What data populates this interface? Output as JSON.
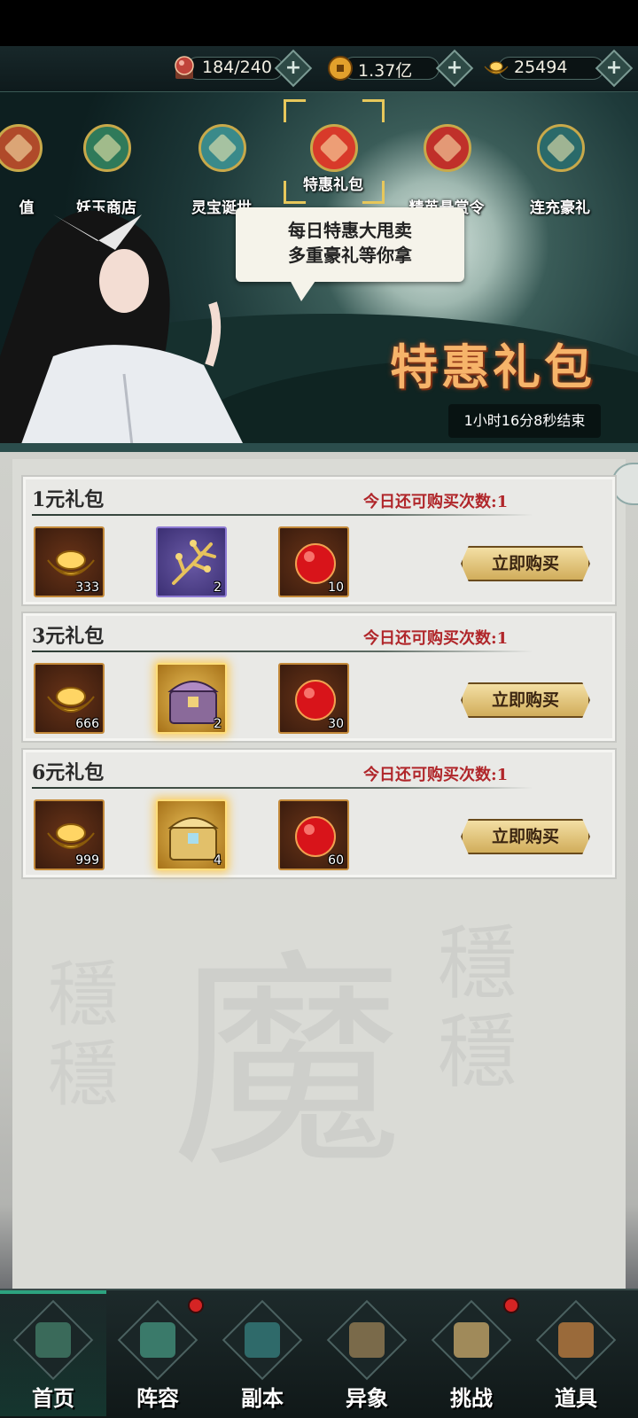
{
  "resources": [
    {
      "name": "stamina",
      "value": "184/240",
      "icon": "stamina-orb-icon",
      "color": "#c0443a"
    },
    {
      "name": "coins",
      "value": "1.37亿",
      "icon": "coin-icon",
      "color": "#e2a02c"
    },
    {
      "name": "gold_ingots",
      "value": "25494",
      "icon": "gold-ingot-icon",
      "color": "#f0b834"
    }
  ],
  "banner": {
    "categories": [
      {
        "label": "值",
        "icon": "recharge-icon",
        "selected": false
      },
      {
        "label": "妖玉商店",
        "icon": "jade-shop-icon",
        "selected": false
      },
      {
        "label": "灵宝诞世",
        "icon": "spirit-treasure-icon",
        "selected": false
      },
      {
        "label": "特惠礼包",
        "icon": "gift-box-icon",
        "selected": true
      },
      {
        "label": "精英悬赏令",
        "icon": "elite-bounty-icon",
        "selected": false
      },
      {
        "label": "连充豪礼",
        "icon": "continuous-recharge-icon",
        "selected": false
      }
    ],
    "bubble_line1": "每日特惠大甩卖",
    "bubble_line2": "多重豪礼等你拿",
    "title": "特惠礼包",
    "timer": "1小时16分8秒结束"
  },
  "packs": [
    {
      "name": "1元礼包",
      "limit": "今日还可购买次数:1",
      "button": "立即购买",
      "items": [
        {
          "icon": "gold-ingot-icon",
          "qty": "333",
          "frame": "std"
        },
        {
          "icon": "golden-branch-icon",
          "qty": "2",
          "frame": "purple"
        },
        {
          "icon": "red-orb-icon",
          "qty": "10",
          "frame": "std"
        }
      ]
    },
    {
      "name": "3元礼包",
      "limit": "今日还可购买次数:1",
      "button": "立即购买",
      "items": [
        {
          "icon": "gold-ingot-icon",
          "qty": "666",
          "frame": "std"
        },
        {
          "icon": "purple-chest-icon",
          "qty": "2",
          "frame": "gold"
        },
        {
          "icon": "red-orb-icon",
          "qty": "30",
          "frame": "std"
        }
      ]
    },
    {
      "name": "6元礼包",
      "limit": "今日还可购买次数:1",
      "button": "立即购买",
      "items": [
        {
          "icon": "gold-ingot-icon",
          "qty": "999",
          "frame": "std"
        },
        {
          "icon": "golden-chest-icon",
          "qty": "4",
          "frame": "gold"
        },
        {
          "icon": "red-orb-icon",
          "qty": "60",
          "frame": "std"
        }
      ]
    }
  ],
  "nav": [
    {
      "label": "首页",
      "icon": "home-pavilion-icon",
      "active": true,
      "badge": false
    },
    {
      "label": "阵容",
      "icon": "lineup-book-icon",
      "active": false,
      "badge": true
    },
    {
      "label": "副本",
      "icon": "sword-dungeon-icon",
      "active": false,
      "badge": false
    },
    {
      "label": "异象",
      "icon": "crossed-swords-icon",
      "active": false,
      "badge": false
    },
    {
      "label": "挑战",
      "icon": "scroll-challenge-icon",
      "active": false,
      "badge": true
    },
    {
      "label": "道具",
      "icon": "item-bag-icon",
      "active": false,
      "badge": false
    }
  ]
}
